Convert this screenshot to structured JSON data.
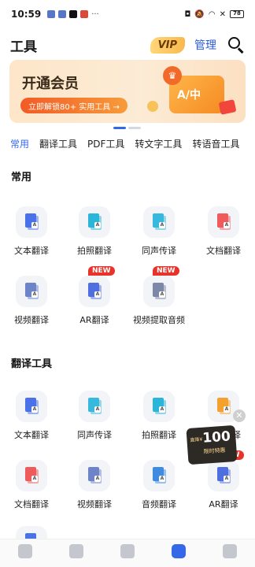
{
  "statusbar": {
    "time": "10:59",
    "battery": "78"
  },
  "appbar": {
    "title": "工具",
    "vip_label": "VIP",
    "manage_label": "管理"
  },
  "banner": {
    "title": "开通会员",
    "cta": "立即解锁80+ 实用工具 →",
    "art_text": "A/中"
  },
  "tabs": [
    {
      "label": "常用",
      "active": true
    },
    {
      "label": "翻译工具"
    },
    {
      "label": "PDF工具"
    },
    {
      "label": "转文字工具"
    },
    {
      "label": "转语音工具"
    }
  ],
  "sections": [
    {
      "title": "常用",
      "items": [
        {
          "label": "文本翻译",
          "icon": "text-translate-icon",
          "color": "#4a72e8"
        },
        {
          "label": "拍照翻译",
          "icon": "photo-translate-icon",
          "color": "#2bb5d8"
        },
        {
          "label": "同声传译",
          "icon": "simultaneous-icon",
          "color": "#36b9dd"
        },
        {
          "label": "文档翻译",
          "icon": "document-translate-icon",
          "color": "#ef5b5b"
        },
        {
          "label": "视频翻译",
          "icon": "video-translate-icon",
          "color": "#6e84c9"
        },
        {
          "label": "AR翻译",
          "icon": "ar-translate-icon",
          "color": "#4f6fe0",
          "badge": "NEW"
        },
        {
          "label": "视频提取音频",
          "icon": "video-audio-icon",
          "color": "#7d88a8",
          "badge": "NEW"
        }
      ]
    },
    {
      "title": "翻译工具",
      "items": [
        {
          "label": "文本翻译",
          "icon": "text-translate-icon",
          "color": "#4a72e8"
        },
        {
          "label": "同声传译",
          "icon": "simultaneous-icon",
          "color": "#36b9dd"
        },
        {
          "label": "拍照翻译",
          "icon": "photo-translate-icon",
          "color": "#2bb5d8"
        },
        {
          "label": "语音翻译",
          "icon": "voice-translate-icon",
          "color": "#f5a130"
        },
        {
          "label": "文档翻译",
          "icon": "document-translate-icon",
          "color": "#ef5b5b"
        },
        {
          "label": "视频翻译",
          "icon": "video-translate-icon",
          "color": "#6e84c9"
        },
        {
          "label": "音频翻译",
          "icon": "audio-translate-icon",
          "color": "#3e8be0"
        },
        {
          "label": "AR翻译",
          "icon": "ar-translate-icon",
          "color": "#4f6fe0",
          "badge": "NEW"
        }
      ]
    }
  ],
  "promo": {
    "amount": "100",
    "tag": "直降¥",
    "sub": "限时特惠"
  },
  "bottom_nav": [
    {
      "icon": "home-icon"
    },
    {
      "icon": "video-icon"
    },
    {
      "icon": "camera-icon"
    },
    {
      "icon": "tools-icon",
      "active": true
    },
    {
      "icon": "profile-icon"
    }
  ],
  "colors": {
    "accent": "#3568e8",
    "new_badge": "#e8332a"
  }
}
